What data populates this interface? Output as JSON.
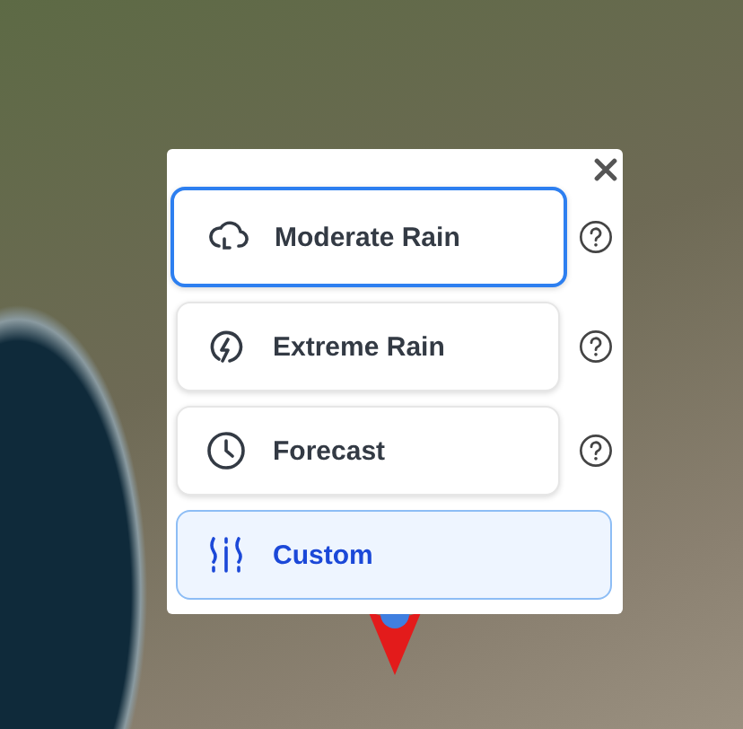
{
  "options": [
    {
      "label": "Moderate Rain",
      "selected": false,
      "focused": true,
      "help": true
    },
    {
      "label": "Extreme Rain",
      "selected": false,
      "focused": false,
      "help": true
    },
    {
      "label": "Forecast",
      "selected": false,
      "focused": false,
      "help": true
    },
    {
      "label": "Custom",
      "selected": true,
      "focused": false,
      "help": false
    }
  ]
}
